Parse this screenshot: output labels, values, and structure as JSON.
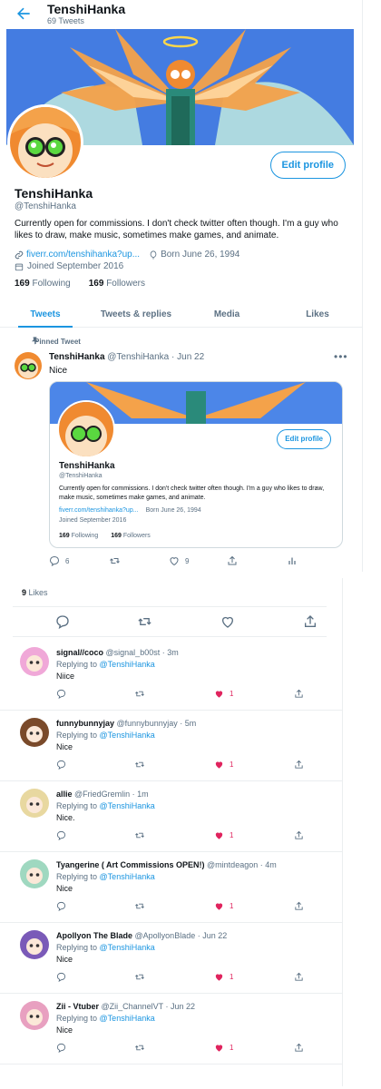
{
  "header": {
    "name": "TenshiHanka",
    "tweet_count": "69 Tweets"
  },
  "profile": {
    "edit_label": "Edit profile",
    "name": "TenshiHanka",
    "handle": "@TenshiHanka",
    "bio": "Currently open for commissions. I don't check twitter often though. I'm a guy who likes to draw, make music, sometimes make games, and animate.",
    "link": "fiverr.com/tenshihanka?up...",
    "born": "Born June 26, 1994",
    "joined": "Joined September 2016",
    "following_count": "169",
    "following_label": "Following",
    "followers_count": "169",
    "followers_label": "Followers"
  },
  "tabs": [
    "Tweets",
    "Tweets & replies",
    "Media",
    "Likes"
  ],
  "pinned": {
    "label": "Pinned Tweet",
    "name": "TenshiHanka",
    "meta": "@TenshiHanka · Jun 22",
    "text": "Nice",
    "replies": "6",
    "likes": "9",
    "card": {
      "edit_label": "Edit profile",
      "name": "TenshiHanka",
      "handle": "@TenshiHanka",
      "bio": "Currently open for commissions. I don't check twitter often though. I'm a guy who likes to draw, make music, sometimes make games, and animate.",
      "link": "fiverr.com/tenshihanka?up...",
      "born": "Born June 26, 1994",
      "joined": "Joined September 2016",
      "following_count": "169",
      "following_label": "Following",
      "followers_count": "169",
      "followers_label": "Followers"
    }
  },
  "likes_section": {
    "count": "9",
    "label": "Likes"
  },
  "replies": [
    {
      "name": "signal//coco",
      "meta": "@signal_b00st · 3m",
      "replying_prefix": "Replying to",
      "replying_to": "@TenshiHanka",
      "text": "Niice",
      "likes": "1",
      "avatar_color": "#f0a8d8"
    },
    {
      "name": "funnybunnyjay",
      "meta": "@funnybunnyjay · 5m",
      "replying_prefix": "Replying to",
      "replying_to": "@TenshiHanka",
      "text": "Nice",
      "likes": "1",
      "avatar_color": "#7a4a2a"
    },
    {
      "name": "allie",
      "meta": "@FriedGremlin · 1m",
      "replying_prefix": "Replying to",
      "replying_to": "@TenshiHanka",
      "text": "Nice.",
      "likes": "1",
      "avatar_color": "#e8d8a0"
    },
    {
      "name": "Tyangerine ( Art Commissions OPEN!)",
      "meta": "@mintdeagon · 4m",
      "replying_prefix": "Replying to",
      "replying_to": "@TenshiHanka",
      "text": "Nice",
      "likes": "1",
      "avatar_color": "#9fd8c0"
    },
    {
      "name": "Apollyon The Blade",
      "meta": "@ApollyonBlade · Jun 22",
      "replying_prefix": "Replying to",
      "replying_to": "@TenshiHanka",
      "text": "Nice",
      "likes": "1",
      "avatar_color": "#7a5ab8"
    },
    {
      "name": "Zii - Vtuber",
      "meta": "@Zii_ChannelVT · Jun 22",
      "replying_prefix": "Replying to",
      "replying_to": "@TenshiHanka",
      "text": "Nice",
      "likes": "1",
      "avatar_color": "#e8a0c0"
    }
  ],
  "colors": {
    "accent": "#1b95e0",
    "like": "#e0245e",
    "banner": "#4c86e8"
  }
}
